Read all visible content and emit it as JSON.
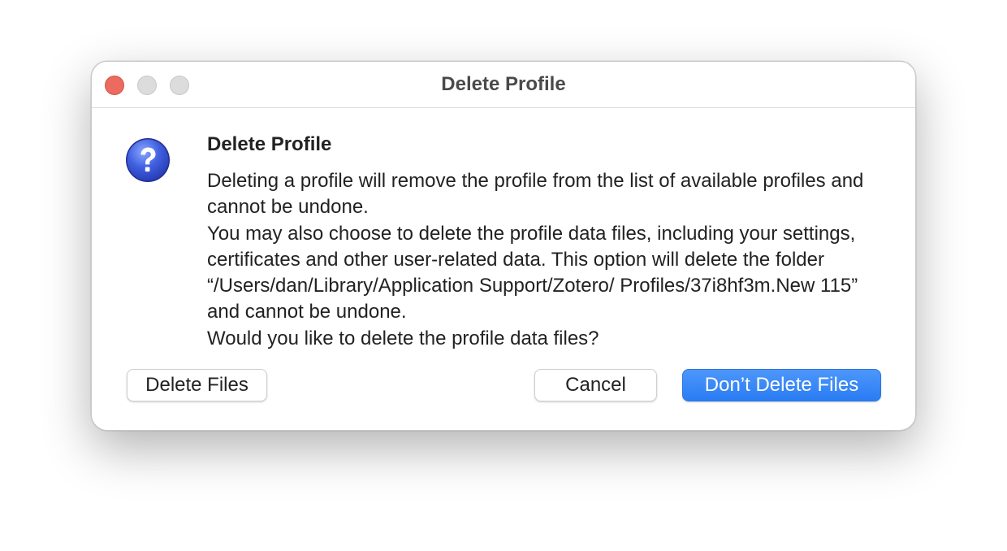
{
  "window": {
    "title": "Delete Profile"
  },
  "dialog": {
    "icon": "question-icon",
    "heading": "Delete Profile",
    "paragraphs": [
      "Deleting a profile will remove the profile from the list of available profiles and cannot be undone.",
      "You may also choose to delete the profile data files, including your settings, certificates and other user-related data. This option will delete the folder “/Users/dan/Library/Application Support/Zotero/ Profiles/37i8hf3m.New 115” and cannot be undone.",
      "Would you like to delete the profile data files?"
    ]
  },
  "buttons": {
    "delete_files": "Delete Files",
    "cancel": "Cancel",
    "dont_delete_files": "Don’t Delete Files"
  },
  "colors": {
    "close": "#ed6a5e",
    "accent": "#2a7cf4"
  }
}
